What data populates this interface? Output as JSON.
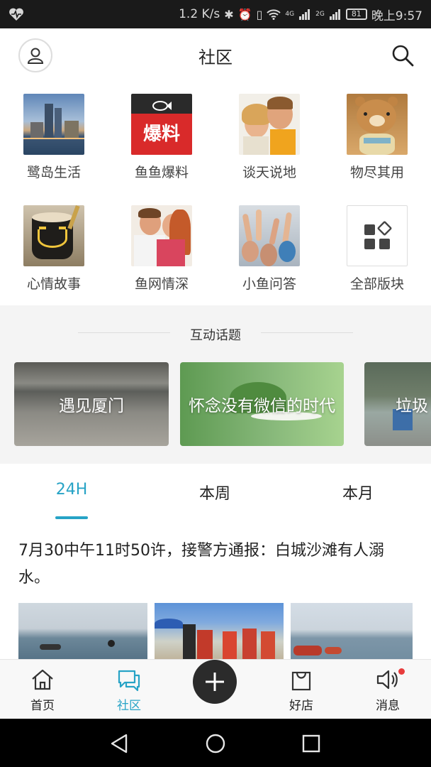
{
  "status_bar": {
    "speed": "1.2 K/s",
    "signal_1_label": "4G",
    "signal_2_label": "2G",
    "battery": "81",
    "time": "晚上9:57"
  },
  "header": {
    "title": "社区"
  },
  "forums": [
    {
      "label": "鹭岛生活",
      "icon": "city-skyline-photo"
    },
    {
      "label": "鱼鱼爆料",
      "icon": "fish-news-logo",
      "badge_text": "爆料"
    },
    {
      "label": "谈天说地",
      "icon": "whispering-kids-photo"
    },
    {
      "label": "物尽其用",
      "icon": "teddy-bear-photo"
    },
    {
      "label": "心情故事",
      "icon": "coffee-cup-photo"
    },
    {
      "label": "鱼网情深",
      "icon": "couple-photo"
    },
    {
      "label": "小鱼问答",
      "icon": "raised-hands-photo"
    },
    {
      "label": "全部版块",
      "icon": "all-sections-grid-icon"
    }
  ],
  "topics": {
    "heading": "互动话题",
    "cards": [
      {
        "title": "遇见厦门"
      },
      {
        "title": "怀念没有微信的时代"
      },
      {
        "title": "垃圾"
      }
    ]
  },
  "tabs": [
    {
      "label": "24H",
      "active": true
    },
    {
      "label": "本周",
      "active": false
    },
    {
      "label": "本月",
      "active": false
    }
  ],
  "post": {
    "title": "7月30中午11时50许，接警方通报：白城沙滩有人溺水。"
  },
  "bottom_nav": [
    {
      "label": "首页",
      "icon": "home-icon",
      "active": false
    },
    {
      "label": "社区",
      "icon": "community-icon",
      "active": true
    },
    {
      "label": "",
      "icon": "plus-icon",
      "active": false
    },
    {
      "label": "好店",
      "icon": "shopping-bag-icon",
      "active": false
    },
    {
      "label": "消息",
      "icon": "speaker-icon",
      "active": false
    }
  ],
  "colors": {
    "accent": "#27a3c6",
    "dark": "#2b2b2b",
    "notification": "#e83c3c"
  }
}
